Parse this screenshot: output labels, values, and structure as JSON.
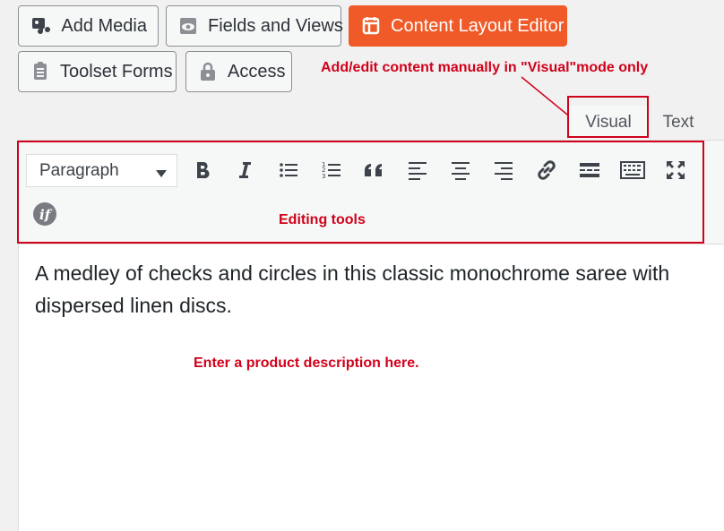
{
  "media_buttons": {
    "add_media": "Add Media",
    "fields_views": "Fields and Views",
    "content_layout": "Content Layout Editor",
    "toolset_forms": "Toolset Forms",
    "access": "Access"
  },
  "annotations": {
    "visual_mode": "Add/edit content manually in \"Visual\"mode only",
    "editing_tools": "Editing tools",
    "description_hint": "Enter a product description here."
  },
  "tabs": {
    "visual": "Visual",
    "text": "Text"
  },
  "toolbar": {
    "format_select": "Paragraph",
    "tools": [
      "bold-icon",
      "italic-icon",
      "bulleted-list-icon",
      "numbered-list-icon",
      "blockquote-icon",
      "align-left-icon",
      "align-center-icon",
      "align-right-icon",
      "link-icon",
      "read-more-icon",
      "toolbar-toggle-icon",
      "fullscreen-icon",
      "conditional-icon"
    ]
  },
  "editor": {
    "content": "A medley of checks and circles in this classic monochrome saree with dispersed linen discs."
  },
  "colors": {
    "accent_orange": "#f05a28",
    "annotation_red": "#d0021b"
  }
}
